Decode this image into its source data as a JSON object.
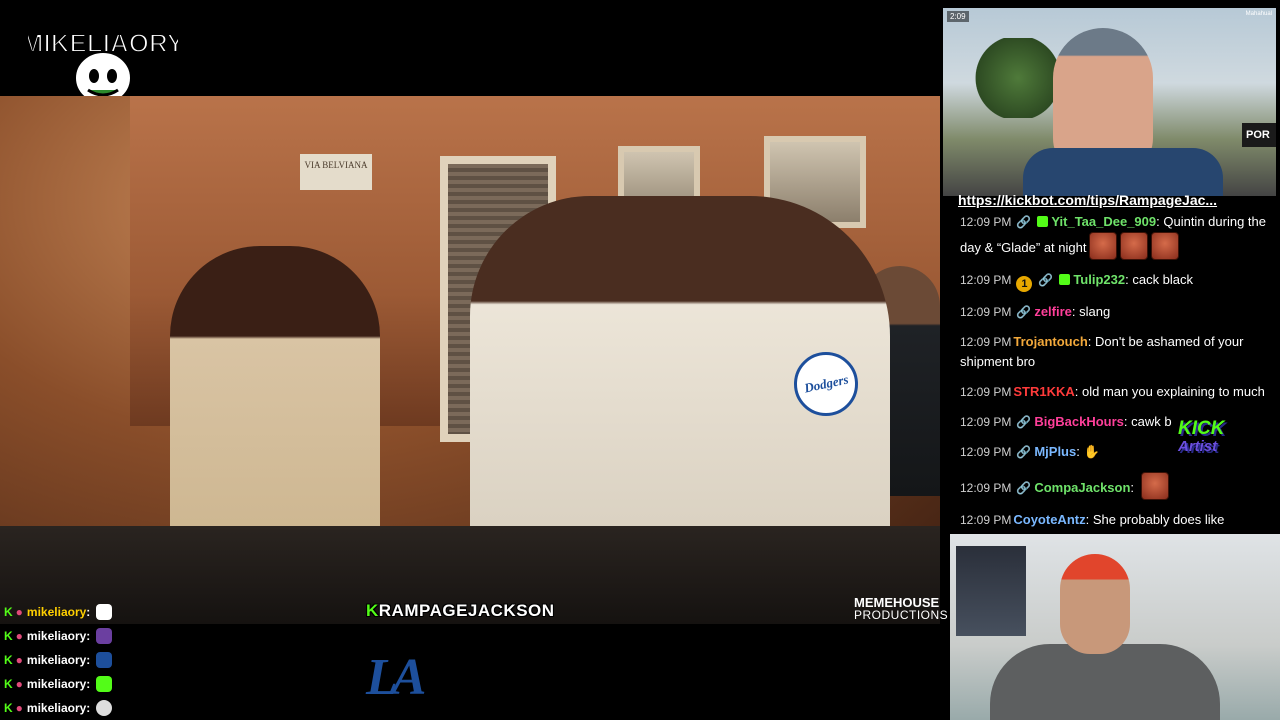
{
  "logo": {
    "text": "MIKELIAORY"
  },
  "video": {
    "street_sign": "VIA BELVIANA",
    "name_plate_k": "K",
    "name_plate_rest": "RAMPAGEJACKSON",
    "watermark_line1": "MEMEHOUSE",
    "watermark_line2": "PRODUCTIONS",
    "dodgers_badge": "Dodgers",
    "la_logo": "LA"
  },
  "left_chat": [
    {
      "name": "mikeliaory",
      "sep": ":",
      "emote_color": "#ffffff"
    },
    {
      "name": "mikeliaory",
      "sep": ":",
      "emote_color": "#6b3fa0"
    },
    {
      "name": "mikeliaory",
      "sep": ":",
      "emote_color": "#1d4f9c"
    },
    {
      "name": "mikeliaory",
      "sep": ":",
      "emote_color": "#53fc18"
    },
    {
      "name": "mikeliaory",
      "sep": ":",
      "emote_color": "#dddddd"
    }
  ],
  "cam_top": {
    "clock": "2:09",
    "location": "Mahahual",
    "sign": "POR"
  },
  "kick_link": "https://kickbot.com/tips/RampageJac...",
  "chat": [
    {
      "time": "12:09 PM",
      "badges": [
        "link",
        "mod"
      ],
      "user": "Yit_Taa_Dee_909",
      "color": "#6fe36a",
      "text": "Quintin during the day & “Glade” at night",
      "emotes": 3
    },
    {
      "time": "12:09 PM",
      "badges": [
        "sub",
        "link",
        "mod"
      ],
      "sub": "1",
      "user": "Tulip232",
      "color": "#6fe36a",
      "text": "cack black",
      "emotes": 0
    },
    {
      "time": "12:09 PM",
      "badges": [
        "link"
      ],
      "user": "zelfire",
      "color": "#ff3f9a",
      "text": "slang",
      "emotes": 0
    },
    {
      "time": "12:09 PM",
      "badges": [],
      "user": "Trojantouch",
      "color": "#f3a93b",
      "text": "Don't be ashamed of your shipment bro",
      "emotes": 0
    },
    {
      "time": "12:09 PM",
      "badges": [],
      "user": "STR1KKA",
      "color": "#ff3b3b",
      "text": "old man you explaining to much",
      "emotes": 0
    },
    {
      "time": "12:09 PM",
      "badges": [
        "link"
      ],
      "user": "BigBackHours",
      "color": "#ff3f9a",
      "text": "cawk b",
      "emotes": 0
    },
    {
      "time": "12:09 PM",
      "badges": [
        "link"
      ],
      "user": "MjPlus",
      "color": "#7ab8ff",
      "text": "",
      "emotes": 0
    },
    {
      "time": "12:09 PM",
      "badges": [
        "link"
      ],
      "user": "CompaJackson",
      "color": "#6fe36a",
      "text": "",
      "emotes": 1
    },
    {
      "time": "12:09 PM",
      "badges": [
        "link"
      ],
      "user": "CoyoteAntz",
      "color": "#7ab8ff",
      "text": "She probably does like",
      "emotes": 0
    }
  ],
  "kick_emote": {
    "line1": "KICK",
    "line2": "Artist"
  }
}
